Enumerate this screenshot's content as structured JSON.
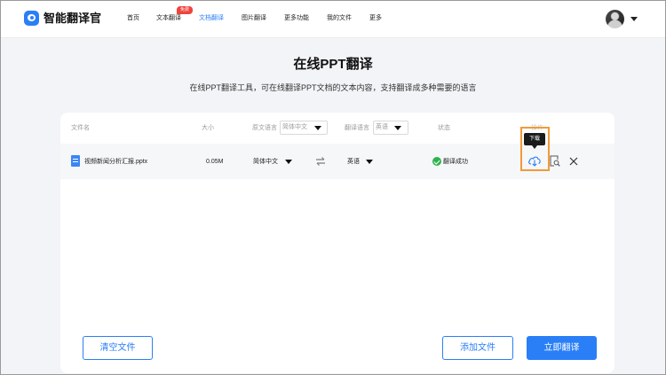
{
  "header": {
    "brand": "智能翻译官",
    "nav": [
      {
        "label": "首页"
      },
      {
        "label": "文本翻译",
        "badge": "免费"
      },
      {
        "label": "文档翻译"
      },
      {
        "label": "图片翻译"
      },
      {
        "label": "更多功能"
      },
      {
        "label": "我的文件"
      },
      {
        "label": "更多"
      }
    ],
    "active_nav": "文档翻译"
  },
  "page": {
    "title": "在线PPT翻译",
    "subtitle": "在线PPT翻译工具，可在线翻译PPT文档的文本内容，支持翻译成多种需要的语言"
  },
  "table": {
    "columns": {
      "filename": "文件名",
      "size": "大小",
      "source_lang": "原文语言",
      "target_lang": "翻译语言",
      "status": "状态",
      "actions": "操作"
    },
    "source_select": "简体中文",
    "target_select": "英语",
    "rows": [
      {
        "filename": "视频新闻分析汇报.pptx",
        "size": "0.05M",
        "source_lang": "简体中文",
        "target_lang": "英语",
        "status": "翻译成功"
      }
    ],
    "download_tooltip": "下载"
  },
  "buttons": {
    "clear": "清空文件",
    "add": "添加文件",
    "translate": "立即翻译"
  },
  "colors": {
    "accent": "#2a7ff7",
    "success": "#30b24d",
    "highlight": "#f29a38",
    "badge": "#f0433c"
  },
  "icons": [
    "app-logo-icon",
    "caret-down-icon",
    "file-icon",
    "swap-icon",
    "check-circle-icon",
    "cloud-download-icon",
    "preview-icon",
    "close-icon"
  ]
}
